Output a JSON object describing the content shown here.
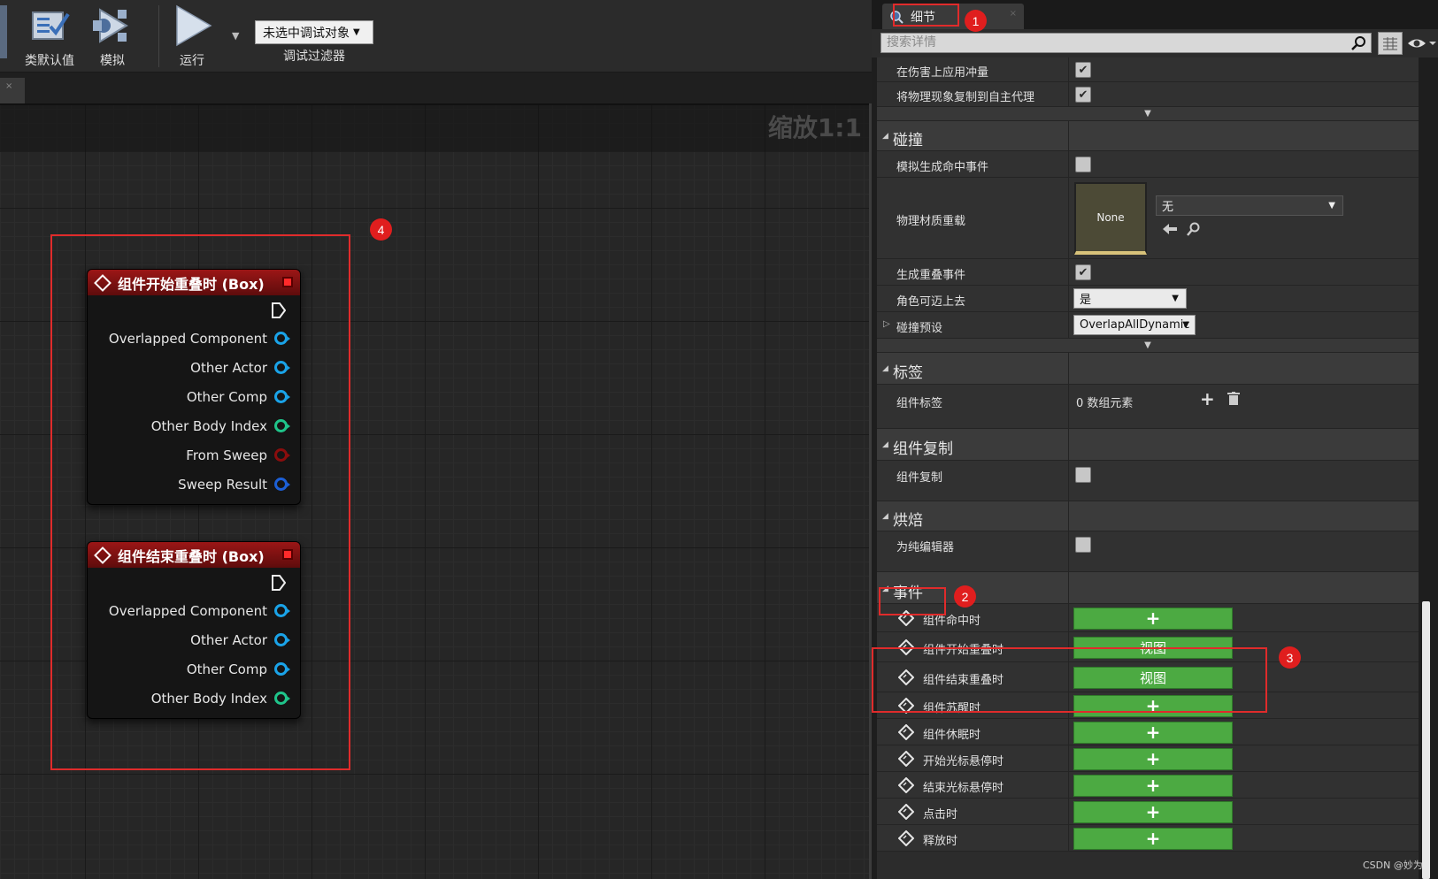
{
  "toolbar": {
    "class_defaults_label": "类默认值",
    "simulate_label": "模拟",
    "run_label": "运行",
    "debug_object_value": "未选中调试对象",
    "debug_filter_label": "调试过滤器"
  },
  "graph": {
    "zoom_label": "缩放1:1",
    "nodes": [
      {
        "title": "组件开始重叠时 (Box)",
        "pins": [
          {
            "label": "Overlapped Component",
            "color": "#1aa3e8"
          },
          {
            "label": "Other Actor",
            "color": "#1aa3e8"
          },
          {
            "label": "Other Comp",
            "color": "#1aa3e8"
          },
          {
            "label": "Other Body Index",
            "color": "#1fc48a"
          },
          {
            "label": "From Sweep",
            "color": "#8a0d0d"
          },
          {
            "label": "Sweep Result",
            "color": "#1c5fd6"
          }
        ]
      },
      {
        "title": "组件结束重叠时 (Box)",
        "pins": [
          {
            "label": "Overlapped Component",
            "color": "#1aa3e8"
          },
          {
            "label": "Other Actor",
            "color": "#1aa3e8"
          },
          {
            "label": "Other Comp",
            "color": "#1aa3e8"
          },
          {
            "label": "Other Body Index",
            "color": "#1fc48a"
          }
        ]
      }
    ]
  },
  "details": {
    "tab_label": "细节",
    "search_placeholder": "搜索详情",
    "physics": {
      "apply_impulse_label": "在伤害上应用冲量",
      "apply_impulse_checked": true,
      "replicate_physics_label": "将物理现象复制到自主代理",
      "replicate_physics_checked": true
    },
    "collision": {
      "title": "碰撞",
      "sim_hit_events_label": "模拟生成命中事件",
      "sim_hit_events_checked": false,
      "phys_material_label": "物理材质重载",
      "phys_material_thumb": "None",
      "phys_material_value": "无",
      "gen_overlap_label": "生成重叠事件",
      "gen_overlap_checked": true,
      "can_step_up_label": "角色可迈上去",
      "can_step_up_value": "是",
      "collision_preset_label": "碰撞预设",
      "collision_preset_value": "OverlapAllDynamic"
    },
    "tags": {
      "title": "标签",
      "component_tags_label": "组件标签",
      "component_tags_value": "0 数组元素"
    },
    "replication": {
      "title": "组件复制",
      "component_replicates_label": "组件复制",
      "component_replicates_checked": false
    },
    "cooking": {
      "title": "烘焙",
      "editor_only_label": "为纯编辑器",
      "editor_only_checked": false
    },
    "events": {
      "title": "事件",
      "items": [
        {
          "label": "组件命中时",
          "button": "+"
        },
        {
          "label": "组件开始重叠时",
          "button": "视图"
        },
        {
          "label": "组件结束重叠时",
          "button": "视图"
        },
        {
          "label": "组件苏醒时",
          "button": "+"
        },
        {
          "label": "组件休眠时",
          "button": "+"
        },
        {
          "label": "开始光标悬停时",
          "button": "+"
        },
        {
          "label": "结束光标悬停时",
          "button": "+"
        },
        {
          "label": "点击时",
          "button": "+"
        },
        {
          "label": "释放时",
          "button": "+"
        }
      ]
    }
  },
  "annotations": [
    "1",
    "2",
    "3",
    "4"
  ],
  "watermark": "CSDN @妙为",
  "colors": {
    "accent_red": "#e02b2b",
    "event_green": "#4caa42",
    "node_header": "#9b1616"
  }
}
